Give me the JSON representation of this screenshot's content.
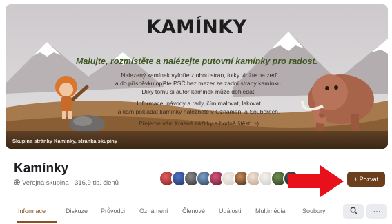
{
  "cover": {
    "title": "KAMÍNKY",
    "tagline": "Malujte, rozmístěte a nalézejte putovní kamínky pro radost.",
    "lines": [
      "Nalezený kamínek vyfoťte z obou stran, fotky vložte na zeď",
      "a do příspěvku opište PSČ bez mezer ze zadní strany kamínku.",
      "Díky tomu si autor kamínek může dohledat.",
      "Informace, návody a rady, čím malovat, lakovat",
      "a kam pokládat kamínky naleznete v Oznámení a Souborech.",
      "Přejeme vám krásné zážitky a hodně štěstí :-)"
    ],
    "caption": "Skupina stránky Kamínky, stránka skupiny"
  },
  "group": {
    "name": "Kamínky",
    "meta": "Veřejná skupina · 316,9 tis. členů"
  },
  "invite_label": "+ Pozvat",
  "tabs": [
    "Informace",
    "Diskuze",
    "Průvodci",
    "Oznámení",
    "Členové",
    "Události",
    "Multimédia",
    "Soubory"
  ],
  "icons": {
    "search": "search-icon",
    "more": "more-icon",
    "globe": "globe-icon"
  },
  "colors": {
    "accent": "#6b3f1e",
    "annotation_arrow": "#e8101a"
  }
}
